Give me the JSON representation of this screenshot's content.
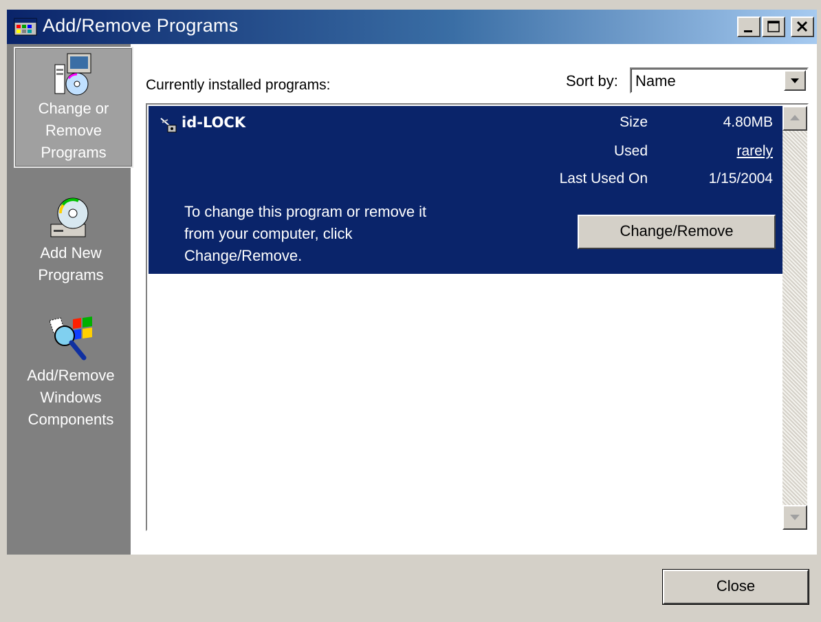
{
  "window": {
    "title": "Add/Remove Programs",
    "controls": [
      "minimize-icon",
      "maximize-icon",
      "close-icon"
    ]
  },
  "sidebar": {
    "items": [
      {
        "label_lines": [
          "Change or",
          "Remove",
          "Programs"
        ],
        "icon": "change-remove-programs-icon",
        "selected": true
      },
      {
        "label_lines": [
          "Add New",
          "Programs"
        ],
        "icon": "cd-install-icon",
        "selected": false
      },
      {
        "label_lines": [
          "Add/Remove",
          "Windows",
          "Components"
        ],
        "icon": "windows-components-icon",
        "selected": false
      }
    ]
  },
  "main": {
    "installed_label": "Currently installed programs:",
    "sort_label": "Sort by:",
    "sort_value": "Name"
  },
  "program": {
    "name": "id-LOCK",
    "size_label": "Size",
    "size_value": "4.80MB",
    "used_label": "Used",
    "used_value": "rarely",
    "last_used_label": "Last Used On",
    "last_used_value": "1/15/2004",
    "description_lines": [
      "To change this program or remove it",
      "from your computer, click",
      "Change/Remove."
    ],
    "button_label": "Change/Remove"
  },
  "footer": {
    "close_label": "Close"
  },
  "colors": {
    "selection": "#0a246a",
    "sidebar": "#808080",
    "face": "#d4d0c8"
  }
}
